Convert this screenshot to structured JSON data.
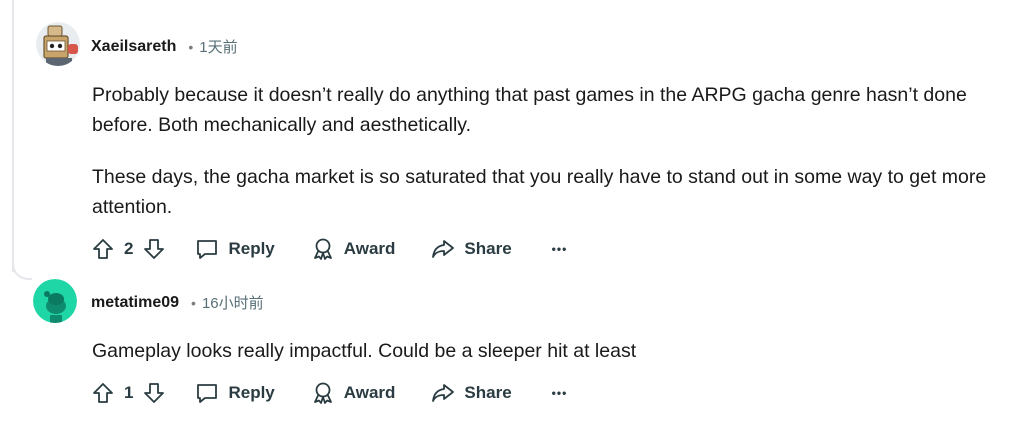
{
  "comments": [
    {
      "author": "Xaeilsareth",
      "dot": "•",
      "time": "1天前",
      "paragraphs": [
        "Probably because it doesn’t really do anything that past games in the ARPG gacha genre hasn’t done before. Both mechanically and aesthetically.",
        "These days, the gacha market is so saturated that you really have to stand out in some way to get more attention."
      ],
      "votes": "2",
      "reply_label": "Reply",
      "award_label": "Award",
      "share_label": "Share",
      "more_label": "•••"
    },
    {
      "author": "metatime09",
      "dot": "•",
      "time": "16小时前",
      "paragraphs": [
        "Gameplay looks really impactful. Could be a sleeper hit at least"
      ],
      "votes": "1",
      "reply_label": "Reply",
      "award_label": "Award",
      "share_label": "Share",
      "more_label": "•••"
    }
  ],
  "icons": {
    "upvote": "upvote-arrow-icon",
    "downvote": "downvote-arrow-icon",
    "reply": "speech-bubble-icon",
    "award": "award-ribbon-icon",
    "share": "share-arrow-icon",
    "more": "ellipsis-icon"
  },
  "colors": {
    "text": "#1a1a1b",
    "meta": "#576f76",
    "action": "#2a3c42",
    "thread_line": "#e5e7ea",
    "avatar2_bg": "#1fd6a6"
  }
}
